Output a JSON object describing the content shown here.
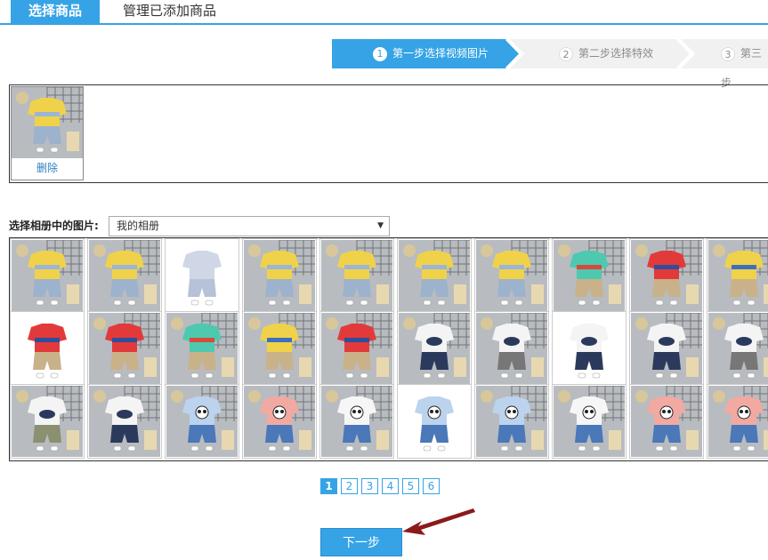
{
  "tabs": [
    {
      "label": "选择商品",
      "active": true
    },
    {
      "label": "管理已添加商品",
      "active": false
    }
  ],
  "steps": [
    {
      "num": "1",
      "label": "第一步选择视频图片",
      "active": true
    },
    {
      "num": "2",
      "label": "第二步选择特效",
      "active": false
    },
    {
      "num": "3",
      "label": "第三步",
      "active": false
    }
  ],
  "selected": {
    "items": [
      {
        "delete_label": "删除",
        "image": "baby-outfit-yellow-denim"
      }
    ]
  },
  "album": {
    "label": "选择相册中的图片:",
    "selected": "我的相册"
  },
  "gallery": {
    "rows": [
      [
        "baby-outfit-yellow-denim",
        "baby-outfit-yellow-denim",
        "baby-romper-white-bg",
        "baby-outfit-yellow-denim",
        "baby-outfit-yellow-denim",
        "baby-outfit-yellow-denim",
        "baby-outfit-yellow-denim",
        "baby-tee-teal-stripe",
        "baby-tee-red-stripe",
        "baby-tee-yellow-stripe"
      ],
      [
        "baby-tee-red-white-bg",
        "baby-tee-red-stripe",
        "baby-tee-teal-stripe",
        "baby-tee-yellow-stripe",
        "baby-tee-red-stripe",
        "baby-tank-whale-navy",
        "baby-tank-whale-grey",
        "baby-tank-whale-white-bg",
        "baby-tank-whale-navy",
        "baby-tank-whale-grey"
      ],
      [
        "baby-tank-whale-olive",
        "baby-tank-whale-navy",
        "baby-shirt-panda-blue",
        "baby-shirt-panda-pink",
        "baby-shirt-panda-white",
        "baby-shirt-panda-blue-white-bg",
        "baby-shirt-panda-blue",
        "baby-shirt-panda-white",
        "baby-shirt-panda-pink",
        "baby-shirt-panda-pink"
      ]
    ]
  },
  "pagination": {
    "pages": [
      "1",
      "2",
      "3",
      "4",
      "5",
      "6"
    ],
    "current": "1"
  },
  "next_button": {
    "label": "下一步"
  },
  "colors": {
    "accent": "#36a3e6",
    "arrow": "#8b1a1a"
  }
}
